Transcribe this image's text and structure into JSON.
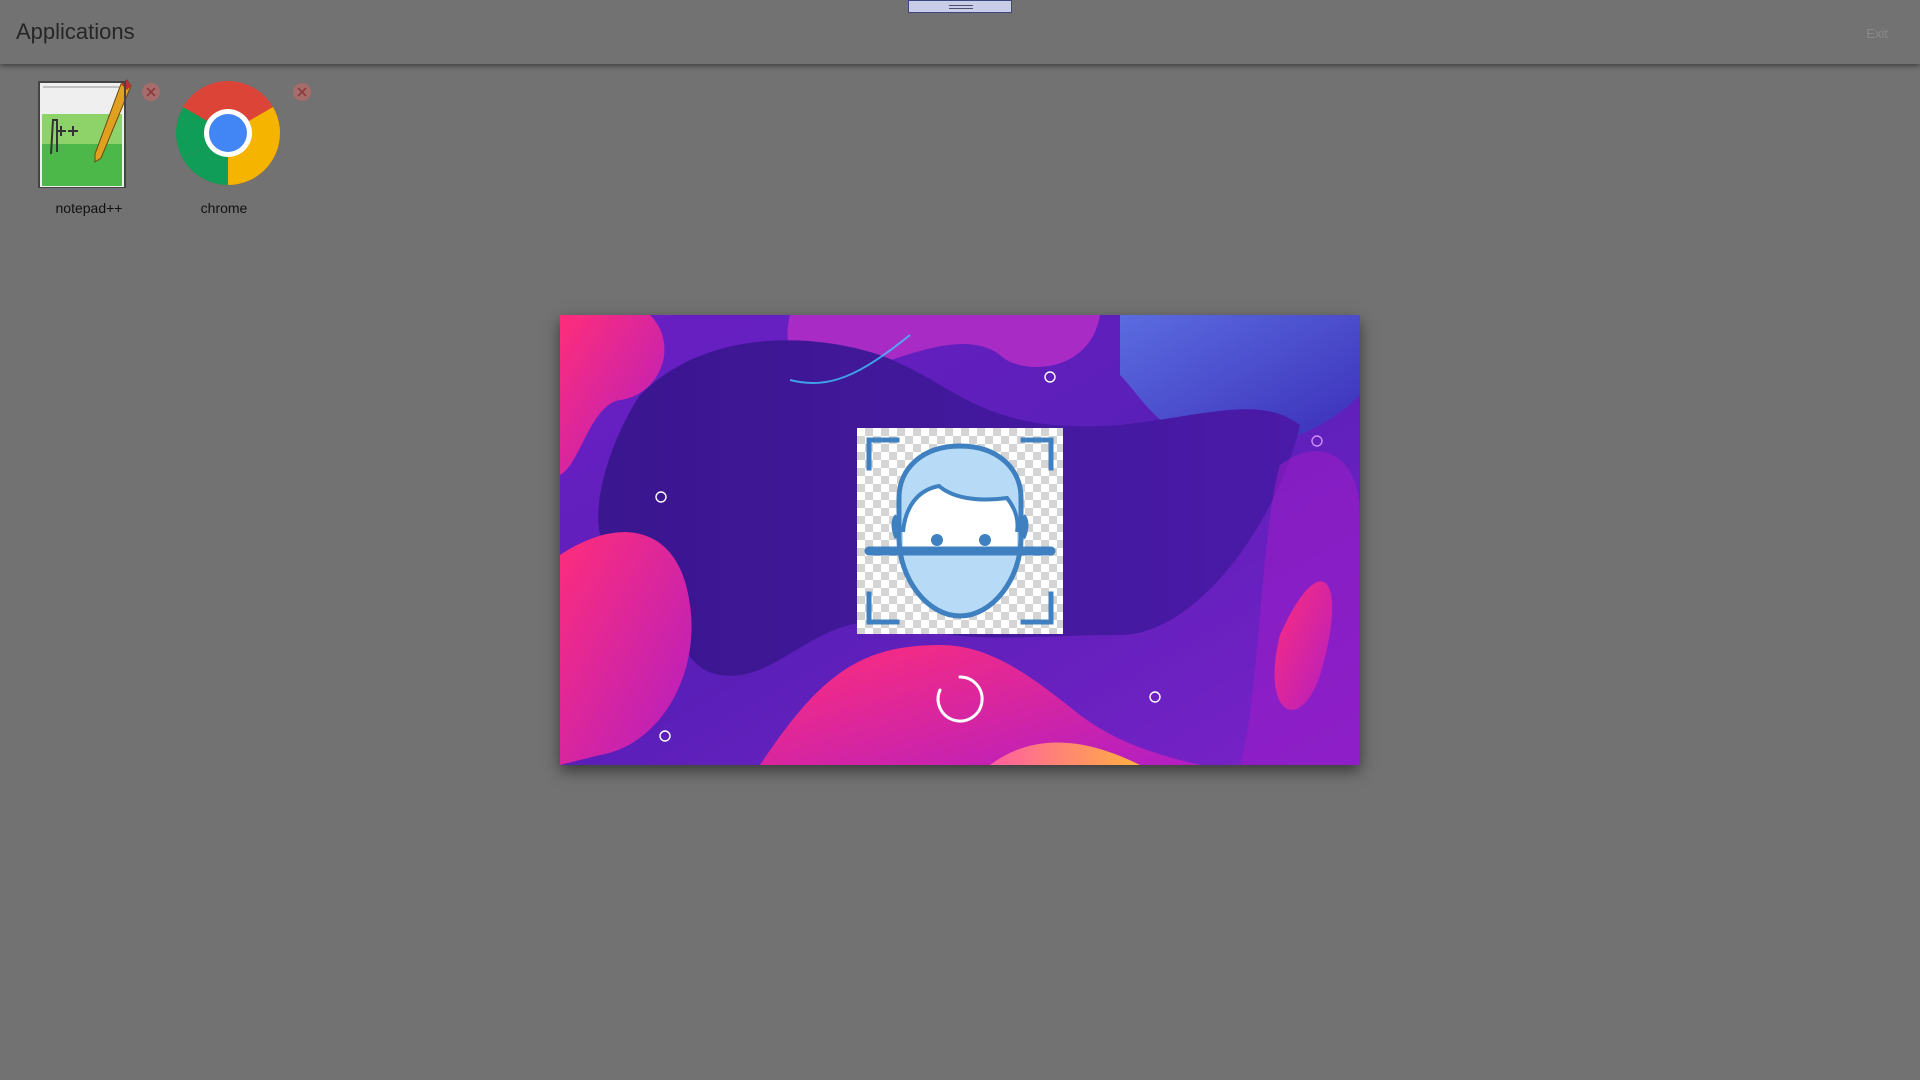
{
  "header": {
    "title": "Applications",
    "exit_label": "Exit"
  },
  "apps": [
    {
      "label": "notepad++",
      "icon": "notepad-plus-plus-icon"
    },
    {
      "label": "chrome",
      "icon": "chrome-icon"
    }
  ],
  "overlay": {
    "center_icon": "face-scan-icon",
    "status_icon": "loading-spinner-icon"
  },
  "colors": {
    "background": "#727272",
    "accent_face": "#3f80c0",
    "modal_purple": "#5a1fb8",
    "modal_pink": "#ff2d7a"
  }
}
